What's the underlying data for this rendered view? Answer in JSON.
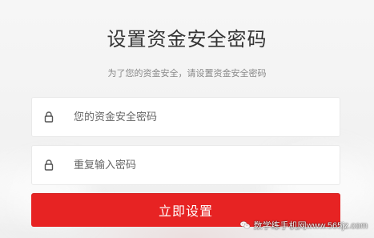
{
  "page": {
    "title": "设置资金安全密码",
    "subtitle": "为了您的资金安全，请设置资金安全密码"
  },
  "form": {
    "fields": [
      {
        "placeholder": "您的资金安全密码",
        "value": "",
        "icon": "lock-icon"
      },
      {
        "placeholder": "重复输入密码",
        "value": "",
        "icon": "lock-icon"
      }
    ],
    "submit_label": "立即设置"
  },
  "watermark": {
    "text": "数学练手机网www.565jz.com"
  },
  "colors": {
    "accent": "#e72323",
    "text_primary": "#333333",
    "text_secondary": "#888888",
    "border": "#e9e9e9",
    "background": "#f3f3f3"
  }
}
